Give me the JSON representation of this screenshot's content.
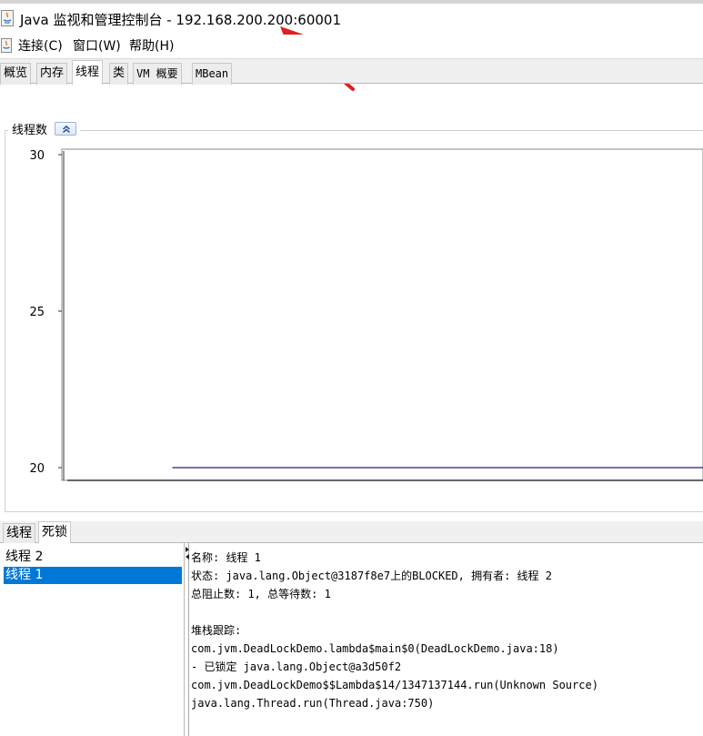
{
  "window": {
    "title": "Java 监视和管理控制台 - 192.168.200.200:60001"
  },
  "menu": {
    "items": [
      "连接(C)",
      "窗口(W)",
      "帮助(H)"
    ]
  },
  "tabs": {
    "items": [
      "概览",
      "内存",
      "线程",
      "类",
      "VM 概要",
      "MBean"
    ],
    "active": "线程"
  },
  "chart_panel": {
    "legend": "线程数",
    "collapse_icon": "double-chevron-up-icon"
  },
  "chart_data": {
    "type": "line",
    "title": "线程数",
    "xlabel": "",
    "ylabel": "",
    "ylim": [
      20,
      30
    ],
    "yticks": [
      "30",
      "25",
      "20"
    ],
    "grid": true,
    "series": [
      {
        "x": [
          0.17,
          1.0
        ],
        "values": [
          20,
          20
        ],
        "color": "#1a1a8c"
      }
    ]
  },
  "lower_tabs": {
    "items": [
      "线程",
      "死锁"
    ],
    "active": "死锁"
  },
  "thread_list": {
    "items": [
      "线程 2",
      "线程 1"
    ],
    "selected_index": 1
  },
  "thread_details": {
    "lines": [
      "名称: 线程 1",
      "状态: java.lang.Object@3187f8e7上的BLOCKED, 拥有者: 线程 2",
      "总阻止数: 1, 总等待数: 1",
      "",
      "堆栈跟踪:",
      "com.jvm.DeadLockDemo.lambda$main$0(DeadLockDemo.java:18)",
      "   - 已锁定 java.lang.Object@a3d50f2",
      "com.jvm.DeadLockDemo$$Lambda$14/1347137144.run(Unknown Source)",
      "java.lang.Thread.run(Thread.java:750)"
    ]
  },
  "colors": {
    "selection": "#0078d7",
    "annotation_arrow": "#e02020",
    "series_line": "#1a1a8c"
  }
}
